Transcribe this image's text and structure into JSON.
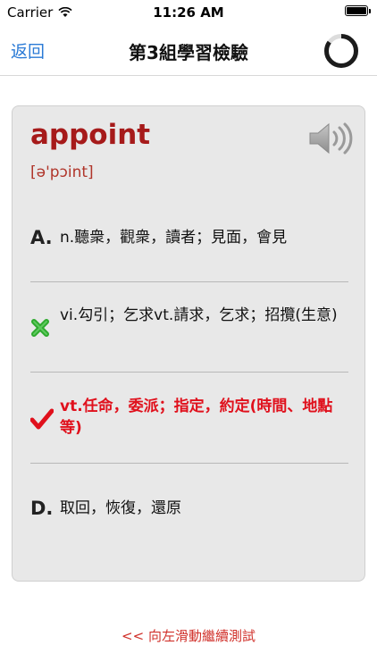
{
  "status_bar": {
    "carrier": "Carrier",
    "time": "11:26 AM"
  },
  "nav": {
    "back_label": "返回",
    "title": "第3組學習檢驗",
    "progress": 0.85
  },
  "card": {
    "word": "appoint",
    "phonetic": "[ə'pɔint]",
    "options": [
      {
        "marker": "A.",
        "state": "neutral",
        "text": "n.聽衆，觀衆，讀者；見面，會見"
      },
      {
        "marker": "",
        "state": "wrong",
        "text": "vi.勾引；乞求vt.請求，乞求；招攬(生意)"
      },
      {
        "marker": "",
        "state": "correct",
        "text": "vt.任命，委派；指定，約定(時間、地點等)"
      },
      {
        "marker": "D.",
        "state": "neutral",
        "text": "取回，恢復，還原"
      }
    ]
  },
  "swipe_hint": "<< 向左滑動繼續測試",
  "colors": {
    "accent": "#2a7ad6",
    "word": "#a61a1a",
    "correct": "#e0101c",
    "wrong_icon": "#2eaa2e"
  }
}
